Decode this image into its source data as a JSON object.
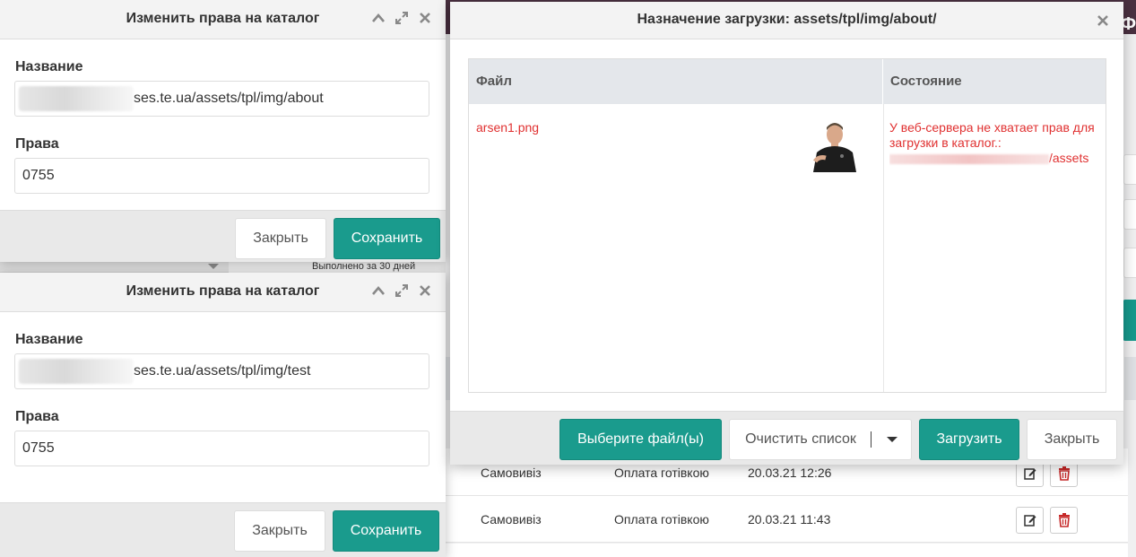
{
  "background": {
    "logo_fragment": "Ф",
    "under_text": "Выполнено за 30 дней",
    "rows": [
      {
        "delivery": "Самовивіз",
        "payment": "Оплата готівкою",
        "date": "20.03.21 12:26"
      },
      {
        "delivery": "Самовивіз",
        "payment": "Оплата готівкою",
        "date": "20.03.21 11:43"
      }
    ]
  },
  "perm_dialog_1": {
    "title": "Изменить права на каталог",
    "name_label": "Название",
    "name_value": "ses.te.ua/assets/tpl/img/about",
    "rights_label": "Права",
    "rights_value": "0755",
    "close_label": "Закрыть",
    "save_label": "Сохранить"
  },
  "perm_dialog_2": {
    "title": "Изменить права на каталог",
    "name_label": "Название",
    "name_value": "ses.te.ua/assets/tpl/img/test",
    "rights_label": "Права",
    "rights_value": "0755",
    "close_label": "Закрыть",
    "save_label": "Сохранить"
  },
  "upload_dialog": {
    "title": "Назначение загрузки: assets/tpl/img/about/",
    "col_file": "Файл",
    "col_status": "Состояние",
    "file_name": "arsen1.png",
    "status_text": "У веб-сервера не хватает прав для загрузки в каталог.:",
    "status_path_tail": "/assets",
    "choose_label": "Выберите файл(ы)",
    "clear_label": "Очистить список",
    "upload_label": "Загрузить",
    "close_label": "Закрыть"
  },
  "colors": {
    "accent_teal": "#1a9b8d",
    "error_red": "#e03030",
    "topbar": "#4a3040"
  },
  "icons": [
    "collapse-icon",
    "expand-icon",
    "close-icon",
    "edit-icon",
    "trash-icon",
    "caret-down-icon"
  ]
}
